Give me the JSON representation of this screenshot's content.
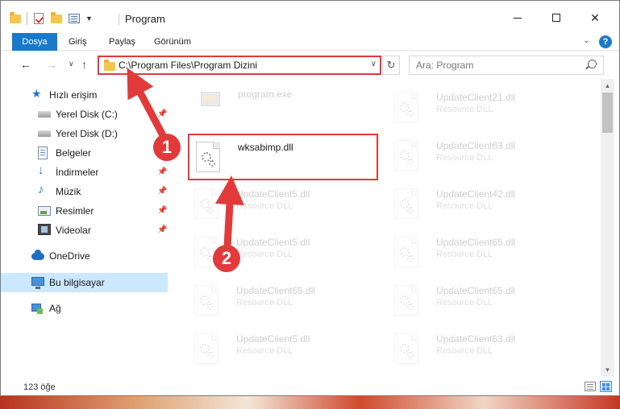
{
  "window": {
    "title": "Program",
    "controls": {
      "minimize": "minimize",
      "maximize": "maximize",
      "close": "close"
    }
  },
  "ribbon": {
    "tabs": [
      {
        "label": "Dosya",
        "active": true
      },
      {
        "label": "Giriş"
      },
      {
        "label": "Paylaş"
      },
      {
        "label": "Görünüm"
      }
    ]
  },
  "navigation": {
    "address_path": "C:\\Program Files\\Program Dizini",
    "search_placeholder": "Ara: Program"
  },
  "sidebar": {
    "quick_access": "Hızlı erişim",
    "items": [
      {
        "label": "Yerel Disk (C:)",
        "pinned": true
      },
      {
        "label": "Yerel Disk (D:)",
        "pinned": false
      },
      {
        "label": "Belgeler",
        "pinned": true
      },
      {
        "label": "İndirmeler",
        "pinned": true
      },
      {
        "label": "Müzik",
        "pinned": true
      },
      {
        "label": "Resimler",
        "pinned": true
      },
      {
        "label": "Videolar",
        "pinned": true
      }
    ],
    "onedrive": "OneDrive",
    "this_pc": "Bu bilgisayar",
    "network": "Ağ"
  },
  "files": {
    "highlighted": {
      "name": "wksabimp.dll"
    },
    "left_column": [
      {
        "name": "program.exe",
        "type": ""
      },
      {
        "name": "UpdateClient5.dll",
        "type": "Resource DLL"
      },
      {
        "name": "UpdateClient5.dll",
        "type": "Resource DLL"
      },
      {
        "name": "UpdateClient65.dll",
        "type": "Resource DLL"
      },
      {
        "name": "UpdateClient5.dll",
        "type": "Resource DLL"
      }
    ],
    "right_column": [
      {
        "name": "UpdateClient21.dll",
        "type": "Resource DLL"
      },
      {
        "name": "UpdateClient63.dll",
        "type": "Resource DLL"
      },
      {
        "name": "UpdateClient42.dll",
        "type": "Resource DLL"
      },
      {
        "name": "UpdateClient65.dll",
        "type": "Resource DLL"
      },
      {
        "name": "UpdateClient65.dll",
        "type": "Resource DLL"
      },
      {
        "name": "UpdateClient63.dll",
        "type": "Resource DLL"
      }
    ]
  },
  "status": {
    "item_count": "123 öğe"
  },
  "annotations": {
    "step1": "1",
    "step2": "2",
    "color": "#e23a3a"
  },
  "colors": {
    "accent": "#1979ca",
    "highlight": "#e23a3a",
    "selected": "#cce8ff"
  }
}
